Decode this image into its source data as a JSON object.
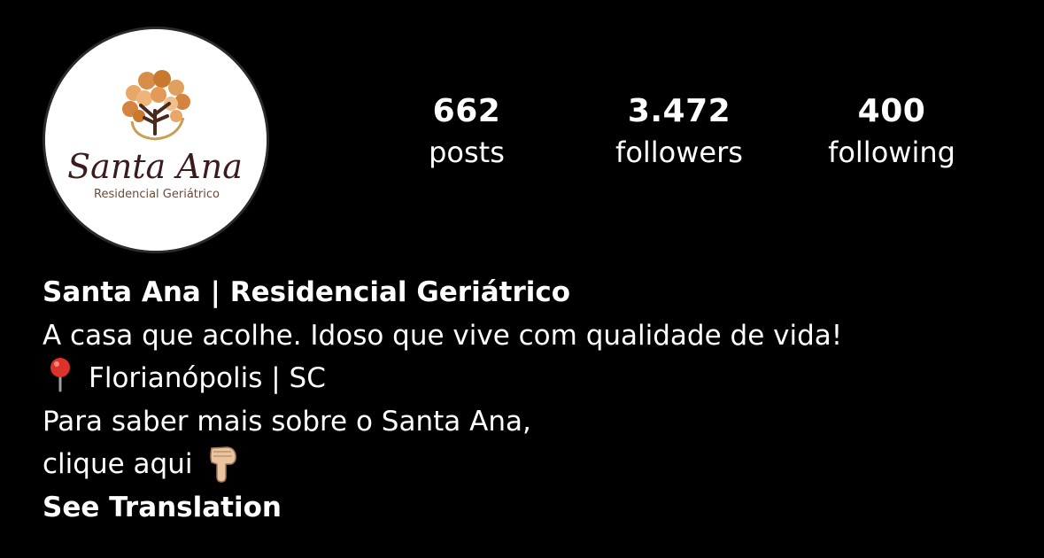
{
  "profile": {
    "logo_name": "Santa Ana",
    "logo_subtitle": "Residencial Geriátrico",
    "display_name": "Santa Ana | Residencial Geriátrico",
    "bio_line1": "A casa que acolhe. Idoso que vive com qualidade de vida!",
    "location": "Florianópolis | SC",
    "bio_line3": "Para saber mais sobre o Santa Ana,",
    "bio_line4": "clique aqui",
    "see_translation": "See Translation"
  },
  "stats": {
    "posts_count": "662",
    "posts_label": "posts",
    "followers_count": "3.472",
    "followers_label": "followers",
    "following_count": "400",
    "following_label": "following"
  },
  "icons": {
    "location": "round-pushpin-icon",
    "pointer": "backhand-index-pointing-down-icon"
  },
  "colors": {
    "background": "#000000",
    "text": "#ffffff",
    "logo_text": "#3a1c1c",
    "logo_accent": "#c8792e"
  }
}
